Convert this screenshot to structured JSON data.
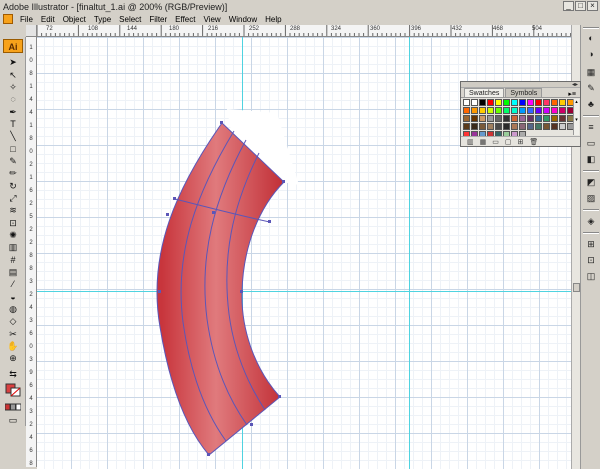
{
  "window": {
    "title": "Adobe Illustrator - [finaltut_1.ai @ 200% (RGB/Preview)]",
    "buttons": [
      "_",
      "□",
      "×"
    ]
  },
  "menubar": {
    "items": [
      "File",
      "Edit",
      "Object",
      "Type",
      "Select",
      "Filter",
      "Effect",
      "View",
      "Window",
      "Help"
    ],
    "doc_buttons": [
      "_",
      "□",
      "×"
    ]
  },
  "toolbox": {
    "badge": "Ai"
  },
  "ruler": {
    "h_labels": [
      "72",
      "108",
      "144",
      "180",
      "216",
      "252",
      "288",
      "324",
      "360",
      "396",
      "432",
      "468",
      "504"
    ],
    "v_labels": [
      "1",
      "0",
      "8",
      "1",
      "4",
      "4",
      "1",
      "8",
      "0",
      "2",
      "1",
      "6",
      "2",
      "5",
      "2",
      "2",
      "8",
      "8",
      "3",
      "2",
      "4",
      "3",
      "6",
      "0",
      "3",
      "9",
      "6",
      "4",
      "3",
      "2",
      "4",
      "6",
      "8"
    ]
  },
  "swatches_panel": {
    "tabs": [
      "Swatches",
      "Symbols"
    ],
    "active_tab": "Swatches",
    "colors": [
      "#ffffff",
      "#ffffff",
      "#000000",
      "#ff0000",
      "#ffff00",
      "#00ff00",
      "#00ffff",
      "#0000ff",
      "#ff00ff",
      "#ff0000",
      "#ff3366",
      "#ff6600",
      "#ffcc00",
      "#ff9900",
      "#ff6600",
      "#ff9900",
      "#ffcc00",
      "#ccff00",
      "#66ff00",
      "#00ff66",
      "#00ffcc",
      "#0099ff",
      "#3366ff",
      "#6600ff",
      "#cc00ff",
      "#ff00cc",
      "#cc0066",
      "#990033",
      "#996633",
      "#663300",
      "#cc9966",
      "#999999",
      "#666666",
      "#333333",
      "#cc6633",
      "#996699",
      "#663366",
      "#336699",
      "#339966",
      "#996600",
      "#663333",
      "#8a7a4a",
      "#5a3a1a",
      "#3a2a1a",
      "#7a5a3a",
      "#a08060",
      "#4a4a4a",
      "#2a2a2a",
      "#aa7755",
      "#886677",
      "#556688",
      "#447766",
      "#775533",
      "#553322",
      "#cccccc",
      "#999999",
      "#ff3333",
      "#993399",
      "#6699cc",
      "#cc3333",
      "#336666",
      "#99cc99",
      "#cc99cc",
      "#aaaaaa"
    ]
  }
}
